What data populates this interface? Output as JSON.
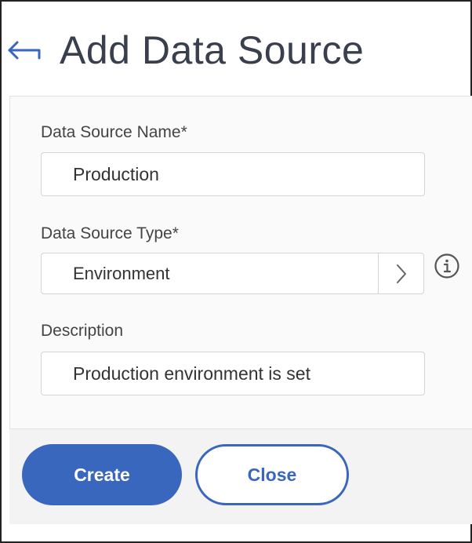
{
  "header": {
    "title": "Add Data Source",
    "back_icon": "arrow-left-icon"
  },
  "form": {
    "name": {
      "label": "Data Source Name*",
      "value": "Production"
    },
    "type": {
      "label": "Data Source Type*",
      "value": "Environment",
      "chevron_icon": "chevron-right-icon",
      "info_icon": "info-circle-icon"
    },
    "description": {
      "label": "Description",
      "value": "Production environment is set"
    }
  },
  "actions": {
    "create_label": "Create",
    "close_label": "Close"
  },
  "colors": {
    "accent": "#3a67be",
    "title": "#3a3f4d",
    "panel_bg": "#fafafa",
    "footer_bg": "#f3f3f3"
  }
}
